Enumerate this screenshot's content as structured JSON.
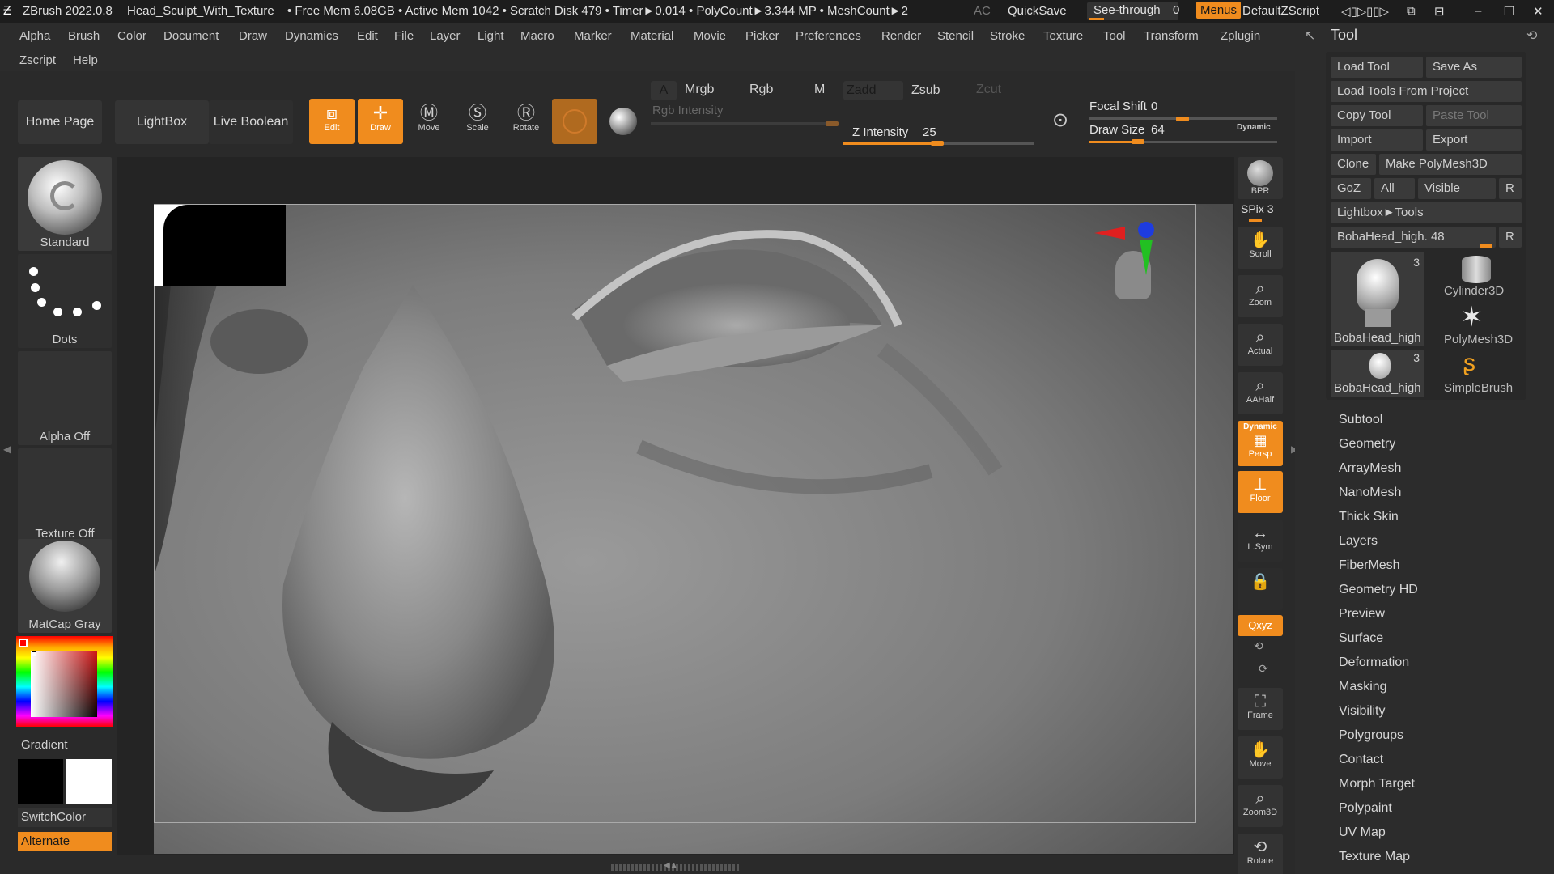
{
  "titlebar": {
    "app": "ZBrush 2022.0.8",
    "document": "Head_Sculpt_With_Texture",
    "stats": "• Free Mem 6.08GB • Active Mem 1042 • Scratch Disk 479 • Timer►0.014 • PolyCount►3.344 MP • MeshCount►2",
    "ac": "AC",
    "quicksave": "QuickSave",
    "seethrough_label": "See-through",
    "seethrough_value": "0",
    "menus": "Menus",
    "script": "DefaultZScript"
  },
  "menubar": {
    "row1": [
      "Alpha",
      "Brush",
      "Color",
      "Document",
      "Draw",
      "Dynamics",
      "Edit",
      "File",
      "Layer",
      "Light",
      "Macro",
      "Marker",
      "Material",
      "Movie",
      "Picker",
      "Preferences",
      "Render",
      "Stencil",
      "Stroke",
      "Texture",
      "Tool",
      "Transform",
      "Zplugin"
    ],
    "row2": [
      "Zscript",
      "Help"
    ]
  },
  "toolbar": {
    "home": "Home Page",
    "lightbox": "LightBox",
    "live_boolean": "Live Boolean",
    "edit": "Edit",
    "draw": "Draw",
    "move": "Move",
    "scale": "Scale",
    "rotate": "Rotate",
    "a": "A",
    "mrgb": "Mrgb",
    "rgb": "Rgb",
    "m": "M",
    "rgb_intensity": "Rgb Intensity",
    "zadd": "Zadd",
    "zsub": "Zsub",
    "zcut": "Zcut",
    "z_intensity_label": "Z Intensity",
    "z_intensity_value": "25",
    "focal_shift_label": "Focal Shift",
    "focal_shift_value": "0",
    "draw_size_label": "Draw Size",
    "draw_size_value": "64",
    "dynamic": "Dynamic"
  },
  "leftshelf": {
    "brush": "Standard",
    "stroke": "Dots",
    "alpha": "Alpha Off",
    "texture": "Texture Off",
    "material": "MatCap Gray",
    "gradient": "Gradient",
    "switchcolor": "SwitchColor",
    "alternate": "Alternate",
    "accent": "#f08c1e"
  },
  "rightshelf": {
    "bpr": "BPR",
    "spix_label": "SPix",
    "spix_value": "3",
    "scroll": "Scroll",
    "zoom": "Zoom",
    "actual": "Actual",
    "aahalf": "AAHalf",
    "dynamic": "Dynamic",
    "persp": "Persp",
    "floor": "Floor",
    "lsym": "L.Sym",
    "xyz": "Qxyz",
    "frame": "Frame",
    "move": "Move",
    "zoom3d": "Zoom3D",
    "rotate": "Rotate"
  },
  "toolpanel": {
    "title": "Tool",
    "load_tool": "Load Tool",
    "save_as": "Save As",
    "load_from_project": "Load Tools From Project",
    "copy_tool": "Copy Tool",
    "paste_tool": "Paste Tool",
    "import": "Import",
    "export": "Export",
    "clone": "Clone",
    "make_polymesh": "Make PolyMesh3D",
    "goz": "GoZ",
    "all": "All",
    "visible": "Visible",
    "r": "R",
    "lightbox_tools": "Lightbox►Tools",
    "current_tool_label": "BobaHead_high.",
    "current_tool_value": "48",
    "thumbs": [
      {
        "label": "BobaHead_high",
        "badge": "3"
      },
      {
        "label": "Cylinder3D",
        "badge": ""
      },
      {
        "label": "PolyMesh3D",
        "badge": ""
      },
      {
        "label": "BobaHead_high",
        "badge": "3"
      },
      {
        "label": "SimpleBrush",
        "badge": ""
      }
    ],
    "subpalettes": [
      "Subtool",
      "Geometry",
      "ArrayMesh",
      "NanoMesh",
      "Thick Skin",
      "Layers",
      "FiberMesh",
      "Geometry HD",
      "Preview",
      "Surface",
      "Deformation",
      "Masking",
      "Visibility",
      "Polygroups",
      "Contact",
      "Morph Target",
      "Polypaint",
      "UV Map",
      "Texture Map"
    ]
  }
}
